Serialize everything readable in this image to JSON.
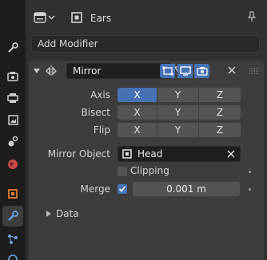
{
  "header": {
    "object_name": "Ears"
  },
  "toolbar": {
    "add_modifier": "Add Modifier"
  },
  "modifier": {
    "name": "Mirror",
    "axis": {
      "label": "Axis",
      "options": [
        "X",
        "Y",
        "Z"
      ],
      "x_on": true,
      "y_on": false,
      "z_on": false
    },
    "bisect": {
      "label": "Bisect",
      "options": [
        "X",
        "Y",
        "Z"
      ]
    },
    "flip": {
      "label": "Flip",
      "options": [
        "X",
        "Y",
        "Z"
      ]
    },
    "mirror_object": {
      "label": "Mirror Object",
      "value": "Head"
    },
    "clipping": {
      "label": "Clipping",
      "checked": false
    },
    "merge": {
      "label": "Merge",
      "checked": true,
      "value": "0.001 m"
    },
    "data_section": {
      "label": "Data",
      "expanded": false
    }
  },
  "colors": {
    "accent": "#4772b3",
    "panel": "#3d3d3d",
    "background": "#303030",
    "tabstrip": "#1d1d1d"
  },
  "icons": {
    "tabs": [
      "tool-icon",
      "render-icon",
      "output-icon",
      "view-layer-icon",
      "scene-icon",
      "world-icon",
      "object-icon",
      "modifier-icon",
      "particles-icon",
      "physics-icon"
    ],
    "active_tab": "modifier-icon"
  }
}
